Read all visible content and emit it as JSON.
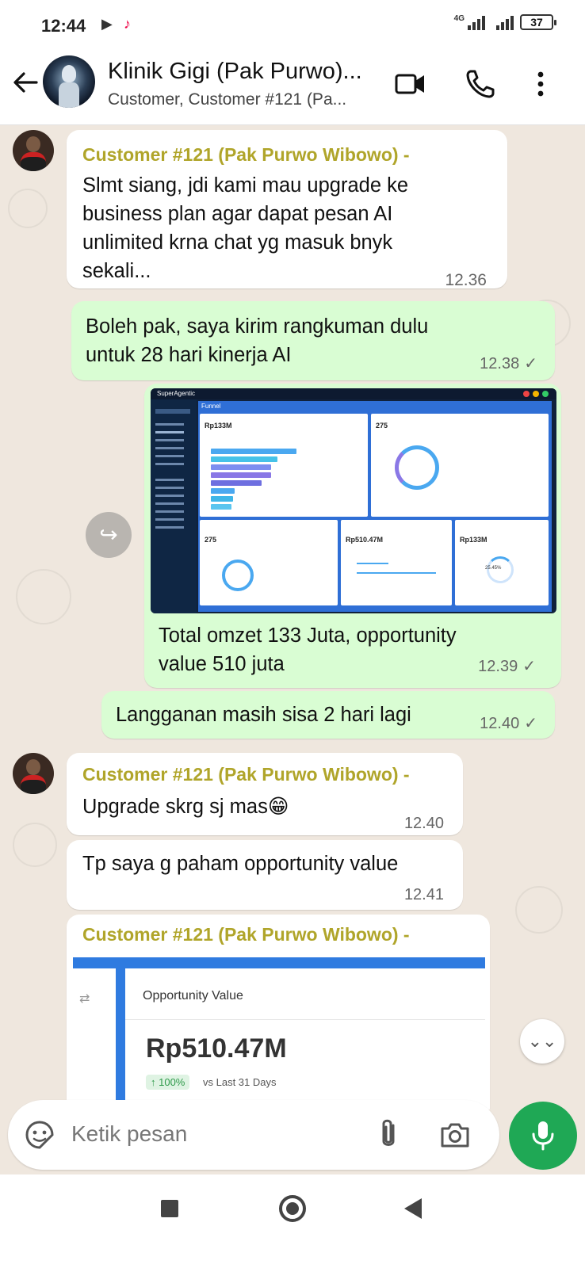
{
  "status_bar": {
    "time": "12:44",
    "network": "4G",
    "battery": "37"
  },
  "header": {
    "title": "Klinik Gigi (Pak Purwo)...",
    "subtitle": "Customer, Customer #121 (Pa..."
  },
  "messages": [
    {
      "direction": "incoming",
      "sender": "Customer #121 (Pak Purwo Wibowo) -",
      "text_lines": [
        "Slmt siang, jdi kami mau upgrade ke",
        "business plan agar dapat pesan AI",
        "unlimited krna chat yg masuk bnyk",
        "sekali..."
      ],
      "time": "12.36"
    },
    {
      "direction": "outgoing",
      "text_lines": [
        "Boleh pak, saya kirim rangkuman dulu",
        "untuk 28 hari kinerja AI"
      ],
      "time": "12.38",
      "status": "✓"
    },
    {
      "direction": "outgoing",
      "image": "dashboard-screenshot",
      "text_lines": [
        "Total omzet 133 Juta, opportunity",
        "value 510 juta"
      ],
      "time": "12.39",
      "status": "✓"
    },
    {
      "direction": "outgoing",
      "text_lines": [
        "Langganan masih sisa 2 hari lagi"
      ],
      "time": "12.40",
      "status": "✓"
    },
    {
      "direction": "incoming",
      "sender": "Customer #121 (Pak Purwo Wibowo) -",
      "text_lines": [
        "Upgrade skrg sj mas😁"
      ],
      "time": "12.40"
    },
    {
      "direction": "incoming",
      "text_lines": [
        "Tp saya g paham opportunity value"
      ],
      "time": "12.41"
    },
    {
      "direction": "incoming",
      "sender": "Customer #121 (Pak Purwo Wibowo) -",
      "image": "opportunity-value-screenshot"
    }
  ],
  "dashboard_image": {
    "brand": "SuperAgentic",
    "tab": "Funnel",
    "funnel_value": "Rp133M",
    "stage_count": "275",
    "opportunity_status_value": "275",
    "opportunity_value": "Rp510.47M",
    "conversion_value": "Rp133M",
    "conversion_rate": "25.45%"
  },
  "opportunity_image": {
    "title": "Opportunity Value",
    "value": "Rp510.47M",
    "change": "↑ 100%",
    "comparison": "vs Last 31 Days"
  },
  "composer": {
    "placeholder": "Ketik pesan"
  },
  "colors": {
    "incoming_bubble": "#ffffff",
    "outgoing_bubble": "#d9fdd3",
    "sender_name": "#b0a52a",
    "accent_green": "#1fa855",
    "chat_background": "#efe7de"
  }
}
